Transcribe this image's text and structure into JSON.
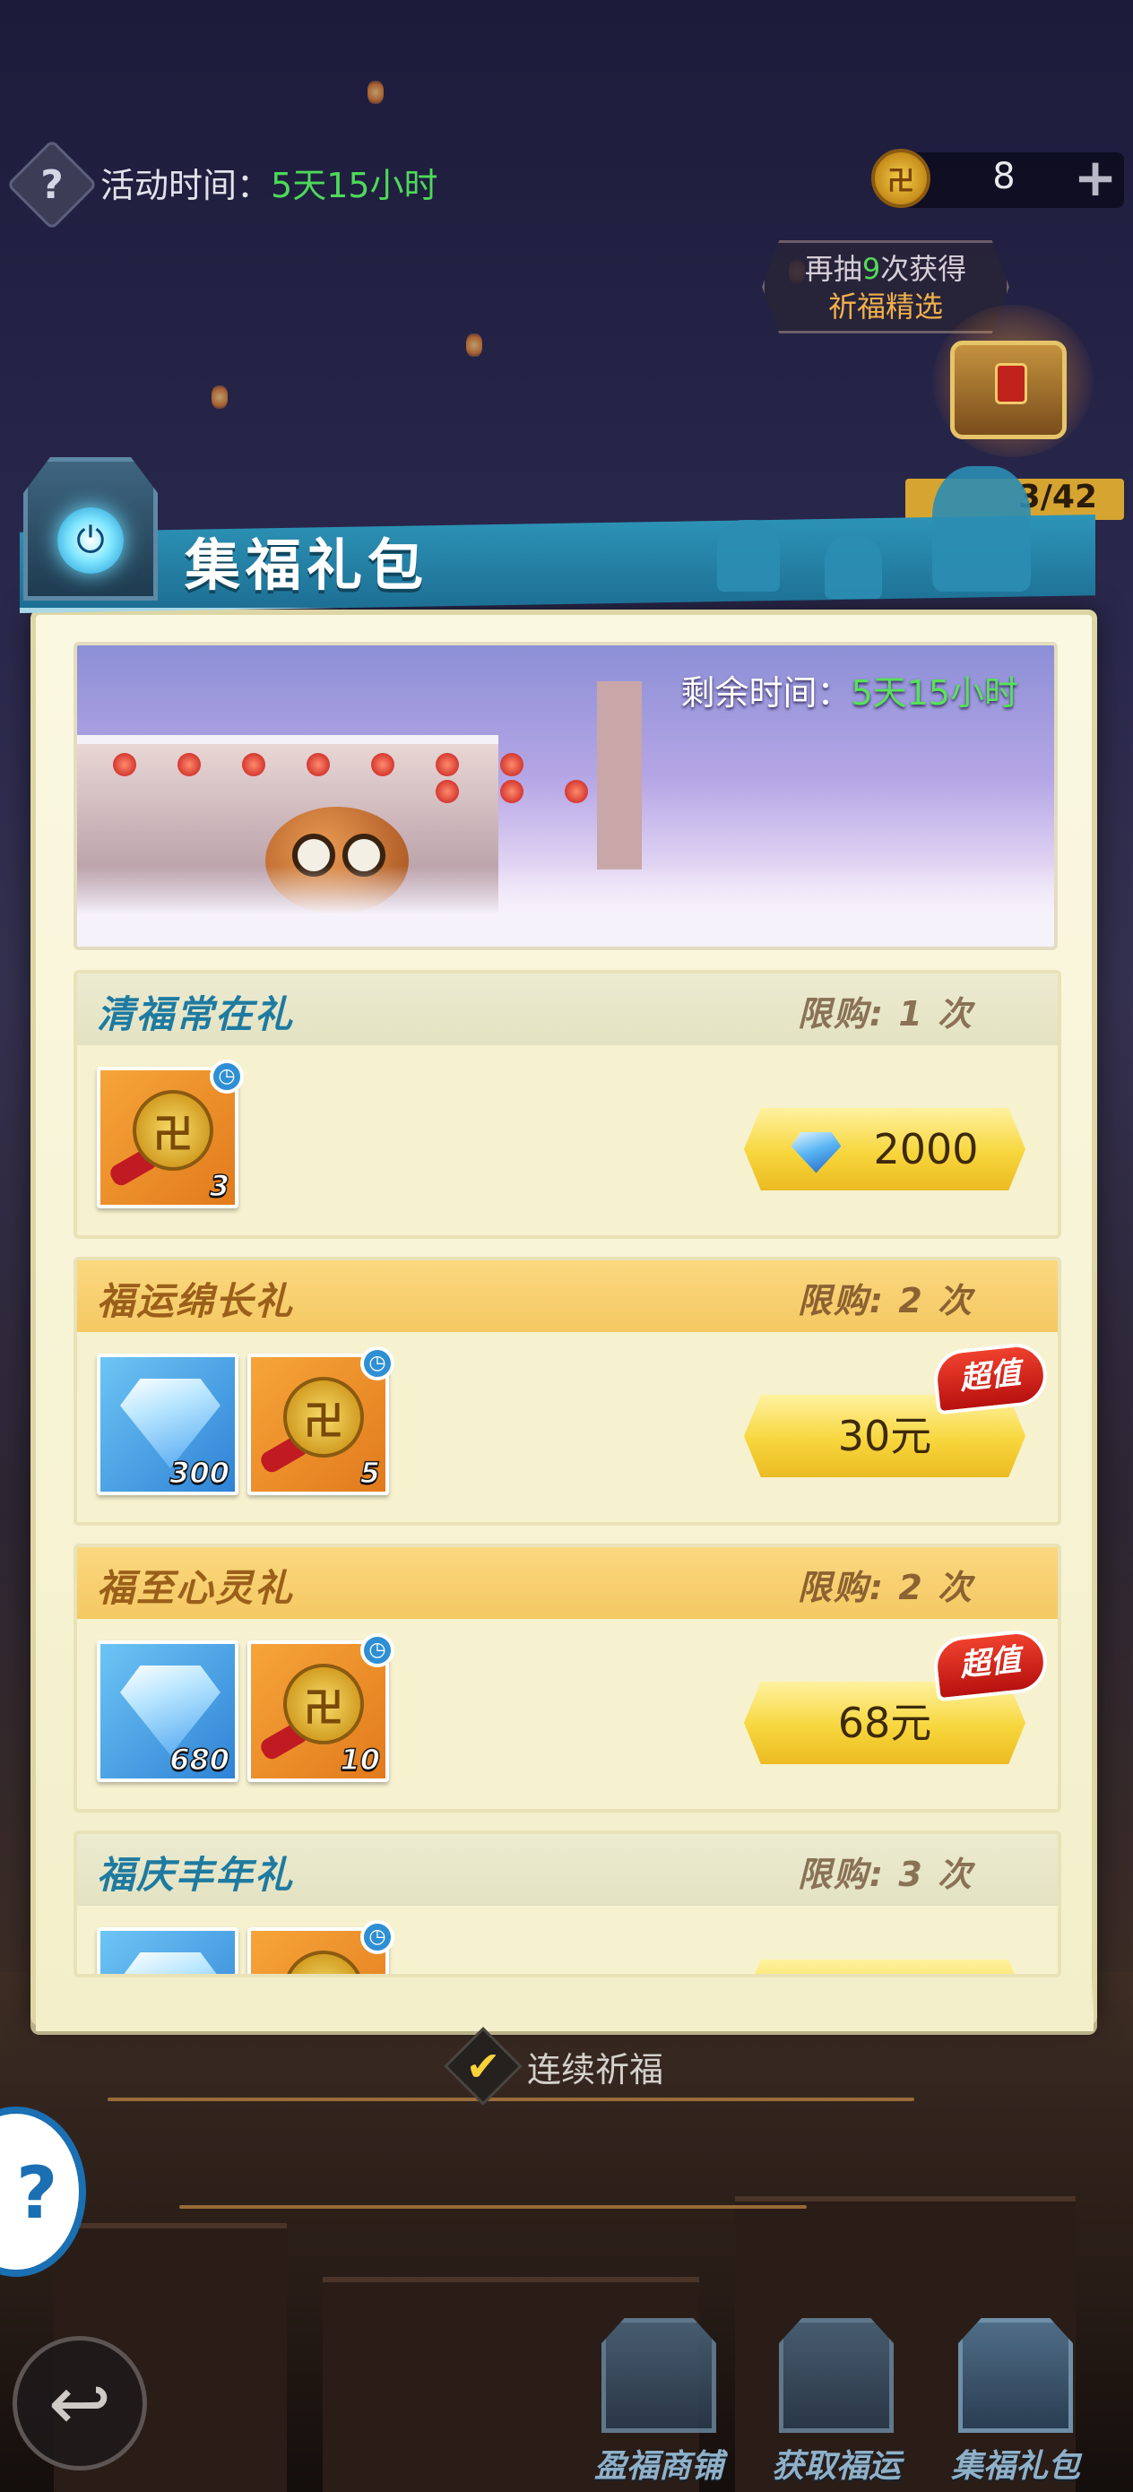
{
  "top_bar": {
    "help_icon": "question-icon",
    "event_time_label": "活动时间：",
    "event_time_value": "5天15小时",
    "currency_icon": "lucky-charm-icon",
    "currency_amount": "8",
    "plus_icon": "plus-icon"
  },
  "draw_hint": {
    "prefix": "再抽",
    "count": "9",
    "suffix": "次获得",
    "reward": "祈福精选"
  },
  "chest": {
    "icon": "treasure-chest-icon",
    "progress": "3/42"
  },
  "panel": {
    "title": "集福礼包",
    "banner_remaining_label": "剩余时间：",
    "banner_remaining_value": "5天15小时"
  },
  "packages": [
    {
      "name": "清福常在礼",
      "limit": "限购: 1 次",
      "items": [
        {
          "type": "lucky-charm",
          "qty": "3",
          "timed": true
        }
      ],
      "price": "2000",
      "price_currency": "diamond",
      "badge": ""
    },
    {
      "name": "福运绵长礼",
      "limit": "限购: 2 次",
      "items": [
        {
          "type": "diamond",
          "qty": "300",
          "timed": false
        },
        {
          "type": "lucky-charm",
          "qty": "5",
          "timed": true
        }
      ],
      "price": "30元",
      "price_currency": "cny",
      "badge": "超值"
    },
    {
      "name": "福至心灵礼",
      "limit": "限购: 2 次",
      "items": [
        {
          "type": "diamond",
          "qty": "680",
          "timed": false
        },
        {
          "type": "lucky-charm",
          "qty": "10",
          "timed": true
        }
      ],
      "price": "68元",
      "price_currency": "cny",
      "badge": "超值"
    },
    {
      "name": "福庆丰年礼",
      "limit": "限购: 3 次",
      "items": [
        {
          "type": "diamond",
          "qty": "",
          "timed": false
        },
        {
          "type": "lucky-charm",
          "qty": "",
          "timed": true
        }
      ],
      "price": "",
      "price_currency": "cny",
      "badge": ""
    }
  ],
  "continue_prayer": {
    "checked": true,
    "label": "连续祈福"
  },
  "nav": {
    "back_icon": "back-arrow-icon",
    "tabs": [
      {
        "label": "盈福商铺",
        "icon": "shop-icon",
        "active": false
      },
      {
        "label": "获取福运",
        "icon": "fortune-scroll-icon",
        "active": false
      },
      {
        "label": "集福礼包",
        "icon": "gift-box-icon",
        "active": true
      }
    ]
  },
  "colors": {
    "highlight_green": "#4ed95a",
    "header_blue": "#2d95b8",
    "gold_header": "#f5c862",
    "price_button": "#f7d63c",
    "value_badge_red": "#d4251c"
  }
}
